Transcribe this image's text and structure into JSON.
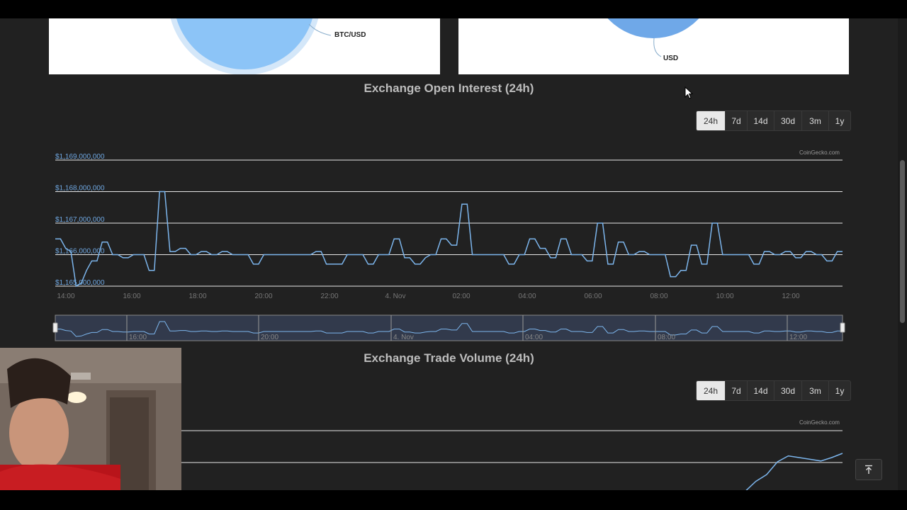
{
  "pie_cards": [
    {
      "slice_label": "BTC/USD",
      "slice_color": "#8cc4f7"
    },
    {
      "slice_label": "USD",
      "slice_color": "#6fa8e8"
    }
  ],
  "sections": {
    "open_interest": {
      "title": "Exchange Open Interest (24h)"
    },
    "trade_volume": {
      "title": "Exchange Trade Volume (24h)"
    }
  },
  "range_buttons": [
    {
      "label": "24h",
      "active": true
    },
    {
      "label": "7d"
    },
    {
      "label": "14d"
    },
    {
      "label": "30d"
    },
    {
      "label": "3m"
    },
    {
      "label": "1y"
    }
  ],
  "credit": "CoinGecko.com",
  "colors": {
    "line": "#7cb5ec",
    "axis_label": "#6ea6e0",
    "page_bg": "#212121"
  },
  "icons": {
    "back_to_top": "arrow-up-to-line-icon",
    "cursor": "mouse-pointer-icon"
  },
  "chart_data": [
    {
      "type": "line",
      "title": "Exchange Open Interest (24h)",
      "ylim": [
        1165000000,
        1169000000
      ],
      "y_ticks": [
        "$1,169,000,000",
        "$1,168,000,000",
        "$1,167,000,000",
        "$1,166,000,000",
        "$1,165,000,000"
      ],
      "x_ticks": [
        "14:00",
        "16:00",
        "18:00",
        "20:00",
        "22:00",
        "4. Nov",
        "02:00",
        "04:00",
        "06:00",
        "08:00",
        "10:00",
        "12:00"
      ],
      "navigator_ticks": [
        "16:00",
        "20:00",
        "4. Nov",
        "04:00",
        "08:00",
        "12:00"
      ],
      "series": [
        {
          "values": [
            1166500000,
            1166500000,
            1166200000,
            1166100000,
            1165000000,
            1165100000,
            1165500000,
            1165800000,
            1165800000,
            1166400000,
            1166400000,
            1166000000,
            1166000000,
            1165900000,
            1165900000,
            1166000000,
            1166000000,
            1166000000,
            1165500000,
            1165500000,
            1168000000,
            1168000000,
            1166100000,
            1166100000,
            1166200000,
            1166200000,
            1166000000,
            1166000000,
            1166100000,
            1166100000,
            1166000000,
            1166000000,
            1166100000,
            1166100000,
            1166000000,
            1166000000,
            1166000000,
            1166000000,
            1165700000,
            1165700000,
            1166000000,
            1166000000,
            1166000000,
            1166000000,
            1166000000,
            1166000000,
            1166000000,
            1166000000,
            1166000000,
            1166000000,
            1166100000,
            1166100000,
            1165700000,
            1165700000,
            1165700000,
            1165700000,
            1166000000,
            1166000000,
            1166000000,
            1166000000,
            1165700000,
            1165700000,
            1166000000,
            1166000000,
            1166000000,
            1166500000,
            1166500000,
            1165900000,
            1165900000,
            1165700000,
            1165700000,
            1165900000,
            1166000000,
            1166000000,
            1166500000,
            1166500000,
            1166300000,
            1166300000,
            1167600000,
            1167600000,
            1166000000,
            1166000000,
            1166000000,
            1166000000,
            1166000000,
            1166000000,
            1166000000,
            1165700000,
            1165700000,
            1166000000,
            1166000000,
            1166500000,
            1166500000,
            1166200000,
            1166200000,
            1165900000,
            1165900000,
            1166500000,
            1166500000,
            1166000000,
            1166000000,
            1166000000,
            1165800000,
            1165800000,
            1167000000,
            1167000000,
            1165700000,
            1165700000,
            1166400000,
            1166400000,
            1166000000,
            1166000000,
            1166100000,
            1166100000,
            1166000000,
            1166000000,
            1166000000,
            1166000000,
            1165300000,
            1165300000,
            1165500000,
            1165500000,
            1166300000,
            1166300000,
            1165700000,
            1165700000,
            1167000000,
            1167000000,
            1166000000,
            1166000000,
            1166000000,
            1166000000,
            1166000000,
            1166000000,
            1165700000,
            1165700000,
            1166100000,
            1166100000,
            1166000000,
            1166000000,
            1166100000,
            1166100000,
            1165900000,
            1165900000,
            1166100000,
            1166100000,
            1166000000,
            1166000000,
            1165800000,
            1165800000,
            1166100000,
            1166100000
          ]
        }
      ]
    },
    {
      "type": "line",
      "title": "Exchange Trade Volume (24h)",
      "series": [
        {
          "values": [
            0,
            0,
            0.12,
            0.2,
            0.35,
            0.42,
            0.4,
            0.38,
            0.36,
            0.4,
            0.45
          ]
        }
      ]
    }
  ]
}
